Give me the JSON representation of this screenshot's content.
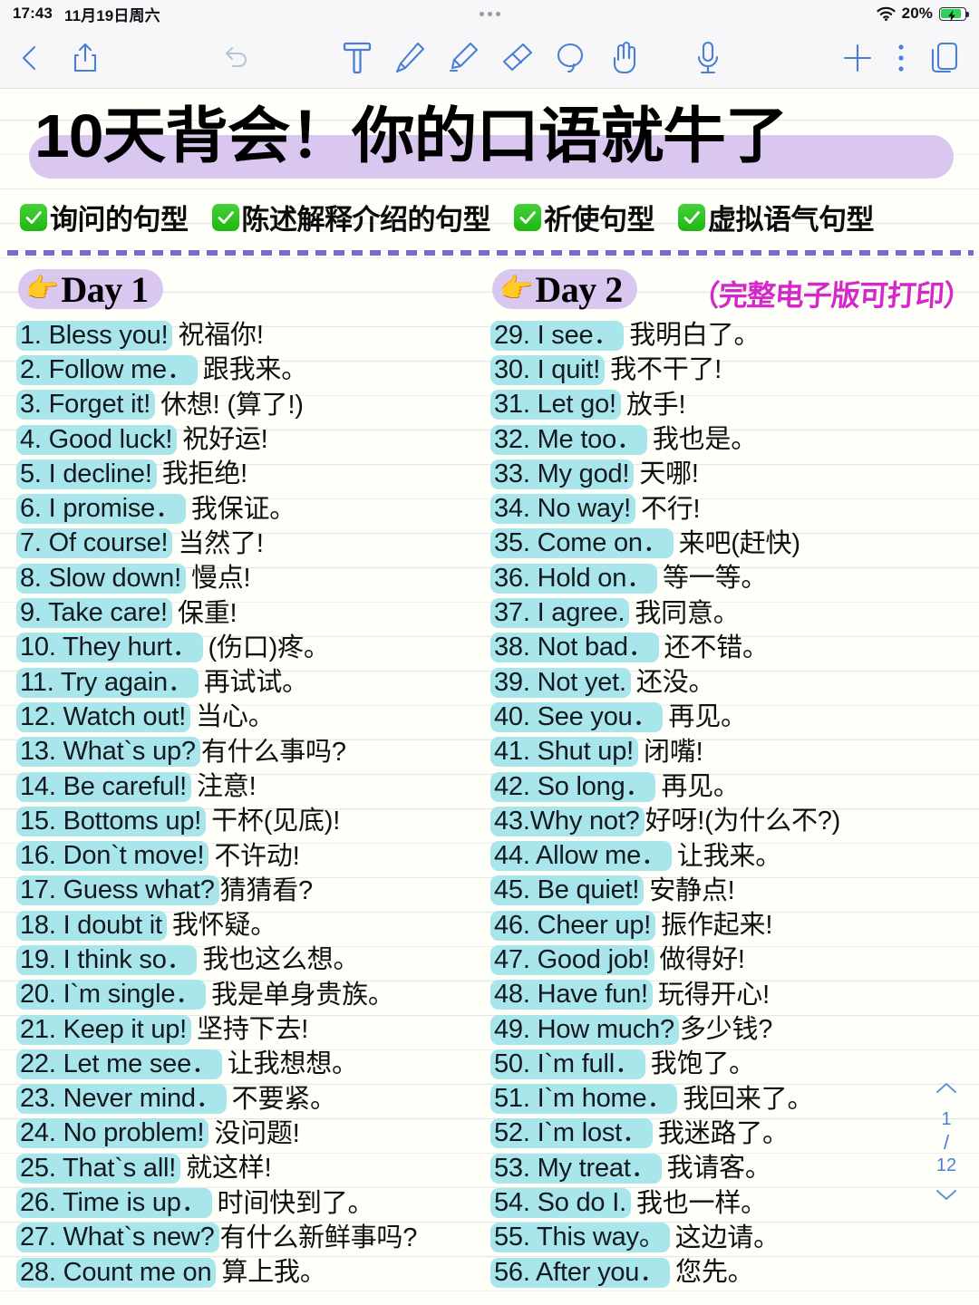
{
  "status_bar": {
    "time": "17:43",
    "date": "11月19日周六",
    "battery_percent": "20%",
    "wifi_icon": "wifi-icon",
    "battery_icon": "battery-charging-icon",
    "more_dots_icon": "three-dots-icon"
  },
  "toolbar": {
    "back_icon": "chevron-left-icon",
    "share_icon": "share-icon",
    "undo_icon": "undo-arrow-icon",
    "tools": [
      {
        "name": "text-tool",
        "icon": "text-T-icon"
      },
      {
        "name": "pen-tool",
        "icon": "pen-icon"
      },
      {
        "name": "highlighter-tool",
        "icon": "highlighter-icon"
      },
      {
        "name": "eraser-tool",
        "icon": "eraser-icon"
      },
      {
        "name": "lasso-tool",
        "icon": "lasso-icon"
      },
      {
        "name": "hand-tool",
        "icon": "hand-pointer-icon"
      }
    ],
    "mic_icon": "microphone-icon",
    "add_icon": "plus-icon",
    "more_icon": "vertical-dots-icon",
    "pages_icon": "pages-copy-icon"
  },
  "document": {
    "title": "10天背会！你的口语就牛了",
    "tags": [
      "询问的句型",
      "陈述解释介绍的句型",
      "祈使句型",
      "虚拟语气句型"
    ],
    "day1_label": "Day 1",
    "day2_label": "Day 2",
    "day_pointer_emoji": "👉",
    "day2_note": "（完整电子版可打印）",
    "columns": {
      "left": [
        {
          "en": "1. Bless you!",
          "zh": "祝福你!"
        },
        {
          "en": "2. Follow me．",
          "zh": "跟我来。"
        },
        {
          "en": "3. Forget it!",
          "zh": "休想! (算了!)"
        },
        {
          "en": "4. Good luck!",
          "zh": "祝好运!"
        },
        {
          "en": "5. I decline!",
          "zh": "我拒绝!"
        },
        {
          "en": "6. I promise．",
          "zh": "我保证。"
        },
        {
          "en": "7. Of course!",
          "zh": "当然了!"
        },
        {
          "en": "8. Slow down!",
          "zh": "慢点!"
        },
        {
          "en": "9. Take care!",
          "zh": "保重!"
        },
        {
          "en": "10. They hurt．",
          "zh": "(伤口)疼。"
        },
        {
          "en": "11. Try again．",
          "zh": "再试试。"
        },
        {
          "en": "12. Watch out!",
          "zh": "当心。"
        },
        {
          "en": "13. What`s up?",
          "zh": "有什么事吗?"
        },
        {
          "en": "14. Be careful!",
          "zh": "注意!"
        },
        {
          "en": "15. Bottoms up!",
          "zh": "干杯(见底)!"
        },
        {
          "en": "16. Don`t move!",
          "zh": "不许动!"
        },
        {
          "en": "17. Guess what?",
          "zh": "猜猜看?"
        },
        {
          "en": "18. I doubt it",
          "zh": "我怀疑。"
        },
        {
          "en": "19. I think so．",
          "zh": "我也这么想。"
        },
        {
          "en": "20. I`m single．",
          "zh": "我是单身贵族。"
        },
        {
          "en": "21. Keep it up!",
          "zh": "坚持下去!"
        },
        {
          "en": "22. Let me see．",
          "zh": "让我想想。"
        },
        {
          "en": "23. Never mind．",
          "zh": "不要紧。"
        },
        {
          "en": "24. No problem!",
          "zh": "没问题!"
        },
        {
          "en": "25. That`s all!",
          "zh": "就这样!"
        },
        {
          "en": "26. Time is up．",
          "zh": "时间快到了。"
        },
        {
          "en": "27. What`s new?",
          "zh": "有什么新鲜事吗?"
        },
        {
          "en": "28. Count me on",
          "zh": "算上我。"
        }
      ],
      "right": [
        {
          "en": "29. I see．",
          "zh": "我明白了。"
        },
        {
          "en": "30. I quit!",
          "zh": "我不干了!"
        },
        {
          "en": "31. Let go!",
          "zh": "放手!"
        },
        {
          "en": "32. Me too．",
          "zh": "我也是。"
        },
        {
          "en": "33. My god!",
          "zh": "天哪!"
        },
        {
          "en": "34. No way!",
          "zh": "不行!"
        },
        {
          "en": "35. Come on．",
          "zh": "来吧(赶快)"
        },
        {
          "en": "36. Hold on．",
          "zh": "等一等。"
        },
        {
          "en": "37. I agree.",
          "zh": "我同意。"
        },
        {
          "en": "38. Not bad．",
          "zh": "还不错。"
        },
        {
          "en": "39. Not yet.",
          "zh": "还没。"
        },
        {
          "en": "40. See you．",
          "zh": "再见。"
        },
        {
          "en": "41. Shut up!",
          "zh": "闭嘴!"
        },
        {
          "en": "42. So long．",
          "zh": "再见。"
        },
        {
          "en": "43.Why not?",
          "zh": "好呀!(为什么不?)"
        },
        {
          "en": "44. Allow me．",
          "zh": "让我来。"
        },
        {
          "en": "45. Be quiet!",
          "zh": "安静点!"
        },
        {
          "en": "46. Cheer up!",
          "zh": "振作起来!"
        },
        {
          "en": "47. Good job!",
          "zh": "做得好!"
        },
        {
          "en": "48. Have fun!",
          "zh": "玩得开心!"
        },
        {
          "en": "49. How much?",
          "zh": "多少钱?"
        },
        {
          "en": "50. I`m full．",
          "zh": "我饱了。"
        },
        {
          "en": "51. I`m home．",
          "zh": "我回来了。"
        },
        {
          "en": "52. I`m lost．",
          "zh": "我迷路了。"
        },
        {
          "en": "53. My treat．",
          "zh": "我请客。"
        },
        {
          "en": "54. So do I.",
          "zh": "我也一样。"
        },
        {
          "en": "55. This way。",
          "zh": "这边请。"
        },
        {
          "en": "56. After you．",
          "zh": "您先。"
        }
      ]
    }
  },
  "page_nav": {
    "up_icon": "chevron-up-icon",
    "down_icon": "chevron-down-icon",
    "current": "1",
    "separator": "/",
    "total": "12"
  },
  "colors": {
    "highlight_cyan": "#a9e6ec",
    "highlight_purple": "#d9c7ef",
    "accent_blue": "#4a7fd4",
    "note_magenta": "#d428c8",
    "check_green": "#1db810",
    "battery_green": "#30d158"
  }
}
